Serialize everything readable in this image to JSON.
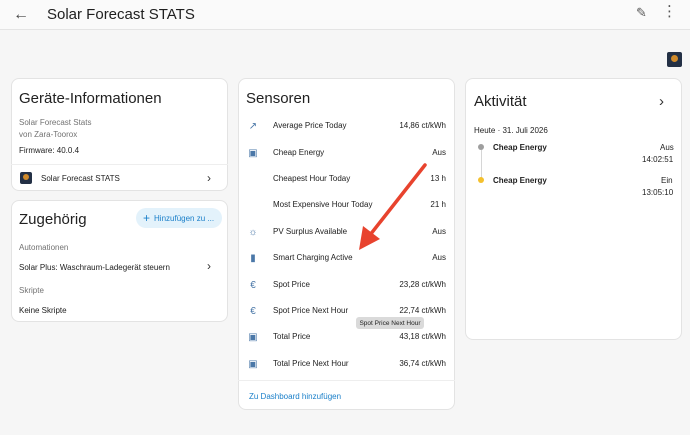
{
  "header": {
    "title": "Solar Forecast STATS",
    "back_icon": "←",
    "edit_icon": "✎",
    "more_icon": "⋮"
  },
  "device_info": {
    "title": "Geräte-Informationen",
    "model": "Solar Forecast Stats",
    "manufacturer": "von Zara-Toorox",
    "firmware": "Firmware: 40.0.4",
    "device_link": "Solar Forecast STATS"
  },
  "related": {
    "title": "Zugehörig",
    "add_button": "Hinzufügen zu ...",
    "automations_label": "Automationen",
    "automation_item": "Solar Plus: Waschraum-Ladegerät steuern",
    "scripts_label": "Skripte",
    "scripts_empty": "Keine Skripte"
  },
  "sensors": {
    "title": "Sensoren",
    "items": [
      {
        "icon": "trending-up-icon",
        "glyph": "↗",
        "name": "Average Price Today",
        "value": "14,86 ct/kWh"
      },
      {
        "icon": "cash-icon",
        "glyph": "▣",
        "name": "Cheap Energy",
        "value": "Aus"
      },
      {
        "icon": "",
        "glyph": "",
        "name": "Cheapest Hour Today",
        "value": "13 h"
      },
      {
        "icon": "",
        "glyph": "",
        "name": "Most Expensive Hour Today",
        "value": "21 h"
      },
      {
        "icon": "solar-power-icon",
        "glyph": "☼",
        "name": "PV Surplus Available",
        "value": "Aus"
      },
      {
        "icon": "battery-charging-icon",
        "glyph": "▮",
        "name": "Smart Charging Active",
        "value": "Aus"
      },
      {
        "icon": "euro-icon",
        "glyph": "€",
        "name": "Spot Price",
        "value": "23,28 ct/kWh"
      },
      {
        "icon": "euro-icon",
        "glyph": "€",
        "name": "Spot Price Next Hour",
        "value": "22,74 ct/kWh"
      },
      {
        "icon": "cash-icon",
        "glyph": "▣",
        "name": "Total Price",
        "value": "43,18 ct/kWh"
      },
      {
        "icon": "cash-icon",
        "glyph": "▣",
        "name": "Total Price Next Hour",
        "value": "36,74 ct/kWh"
      }
    ],
    "tooltip": "Spot Price Next Hour",
    "dashboard_link": "Zu Dashboard hinzufügen"
  },
  "activity": {
    "title": "Aktivität",
    "date": "Heute · 31. Juli 2026",
    "events": [
      {
        "name": "Cheap Energy",
        "state": "Aus",
        "time": "14:02:51",
        "dot_color": "#9e9e9e"
      },
      {
        "name": "Cheap Energy",
        "state": "Ein",
        "time": "13:05:10",
        "dot_color": "#f4c02d"
      }
    ]
  },
  "colors": {
    "accent": "#1a7fc9",
    "annotation_arrow": "#e8432e"
  }
}
